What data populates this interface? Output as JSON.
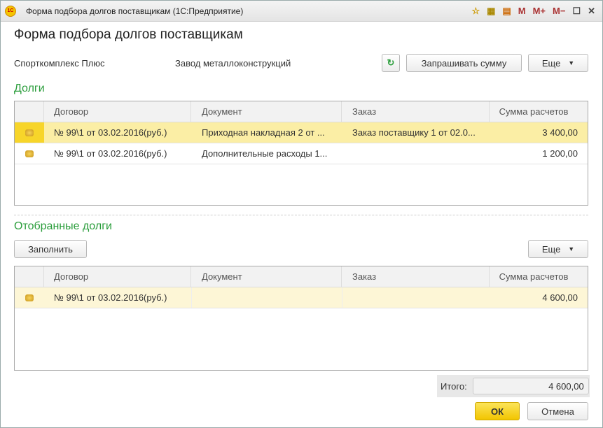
{
  "window": {
    "title": "Форма подбора долгов поставщикам  (1С:Предприятие)",
    "logo": "1С",
    "tools": [
      "M",
      "M+",
      "M−"
    ]
  },
  "form": {
    "title": "Форма подбора долгов поставщикам",
    "org": "Спорткомплекс Плюс",
    "supplier": "Завод металлоконструкций",
    "ask_sum": "Запрашивать сумму",
    "more": "Еще"
  },
  "debts": {
    "title": "Долги",
    "columns": [
      "Договор",
      "Документ",
      "Заказ",
      "Сумма расчетов"
    ],
    "rows": [
      {
        "contract": "№ 99\\1 от 03.02.2016(руб.)",
        "document": "Приходная накладная 2 от ...",
        "order": "Заказ поставщику 1 от 02.0...",
        "sum": "3 400,00"
      },
      {
        "contract": "№ 99\\1 от 03.02.2016(руб.)",
        "document": "Дополнительные расходы 1...",
        "order": "",
        "sum": "1 200,00"
      }
    ]
  },
  "selected": {
    "title": "Отобранные долги",
    "fill": "Заполнить",
    "more": "Еще",
    "columns": [
      "Договор",
      "Документ",
      "Заказ",
      "Сумма расчетов"
    ],
    "rows": [
      {
        "contract": "№ 99\\1 от 03.02.2016(руб.)",
        "document": "",
        "order": "",
        "sum": "4 600,00"
      }
    ]
  },
  "total": {
    "label": "Итого:",
    "value": "4 600,00"
  },
  "footer": {
    "ok": "ОК",
    "cancel": "Отмена"
  }
}
